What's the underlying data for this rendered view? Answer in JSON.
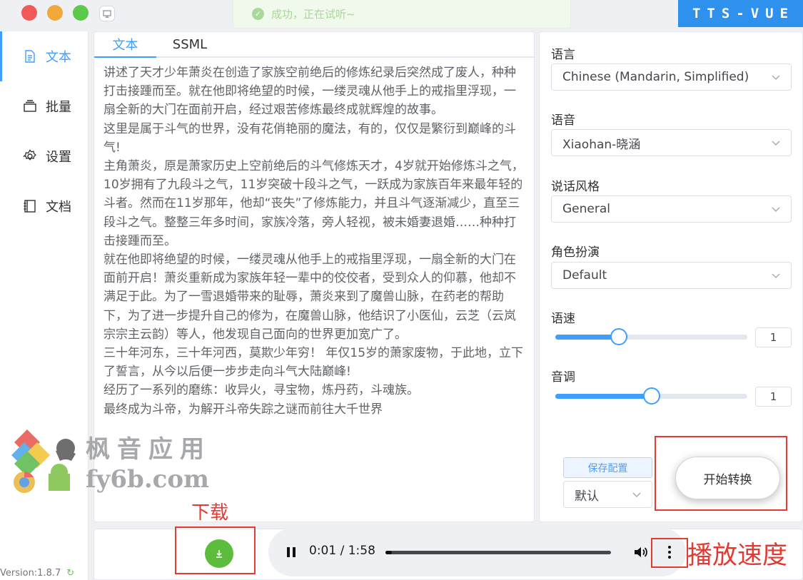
{
  "app": {
    "brand": "TTS-VUE",
    "version": "Version:1.8.7"
  },
  "toast": {
    "message": "成功，正在试听~"
  },
  "sidebar": {
    "items": [
      {
        "label": "文本",
        "icon": "document-icon"
      },
      {
        "label": "批量",
        "icon": "stack-icon"
      },
      {
        "label": "设置",
        "icon": "gear-icon"
      },
      {
        "label": "文档",
        "icon": "notebook-icon"
      }
    ]
  },
  "editor": {
    "tabs": [
      "文本",
      "SSML"
    ],
    "text": "讲述了天才少年萧炎在创造了家族空前绝后的修炼纪录后突然成了废人，种种打击接踵而至。就在他即将绝望的时候，一缕灵魂从他手上的戒指里浮现，一扇全新的大门在面前开启，经过艰苦修炼最终成就辉煌的故事。\n这里是属于斗气的世界，没有花俏艳丽的魔法，有的，仅仅是繁衍到巅峰的斗气!\n主角萧炎，原是萧家历史上空前绝后的斗气修炼天才，4岁就开始修炼斗之气，10岁拥有了九段斗之气，11岁突破十段斗之气，一跃成为家族百年来最年轻的斗者。然而在11岁那年，他却“丧失”了修炼能力，并且斗气逐渐减少，直至三段斗之气。整整三年多时间，家族冷落，旁人轻视，被未婚妻退婚……种种打击接踵而至。\n就在他即将绝望的时候，一缕灵魂从他手上的戒指里浮现，一扇全新的大门在面前开启！萧炎重新成为家族年轻一辈中的佼佼者，受到众人的仰慕，他却不满足于此。为了一雪退婚带来的耻辱，萧炎来到了魔兽山脉，在药老的帮助下，为了进一步提升自己的修为，在魔兽山脉，他结识了小医仙，云芝（云岚宗宗主云韵）等人，他发现自己面向的世界更加宽广了。\n三十年河东，三十年河西，莫欺少年穷！ 年仅15岁的萧家废物，于此地，立下了誓言，从今以后便一步步走向斗气大陆巅峰!\n经历了一系列的磨练：收异火，寻宝物，炼丹药，斗魂族。\n最终成为斗帝，为解开斗帝失踪之谜而前往大千世界"
  },
  "form": {
    "language": {
      "label": "语言",
      "value": "Chinese (Mandarin, Simplified)"
    },
    "voice": {
      "label": "语音",
      "value": "Xiaohan-晓涵"
    },
    "style": {
      "label": "说话风格",
      "value": "General"
    },
    "role": {
      "label": "角色扮演",
      "value": "Default"
    },
    "rate": {
      "label": "语速",
      "value": "1",
      "level": 0.33
    },
    "pitch": {
      "label": "音调",
      "value": "1",
      "level": 0.5
    },
    "save_label": "保存配置",
    "preset_value": "默认",
    "start_label": "开始转换"
  },
  "player": {
    "time": "0:01 / 1:58",
    "progress": 0.01
  },
  "annotations": {
    "download": "下载",
    "speed": "播放速度"
  },
  "watermark": {
    "line1": "枫音应用",
    "line2": "fy6b.com"
  },
  "colors": {
    "accent": "#409eff",
    "brand": "#2f91ee",
    "annotation": "#e33b31",
    "download": "#5cbd3c"
  }
}
